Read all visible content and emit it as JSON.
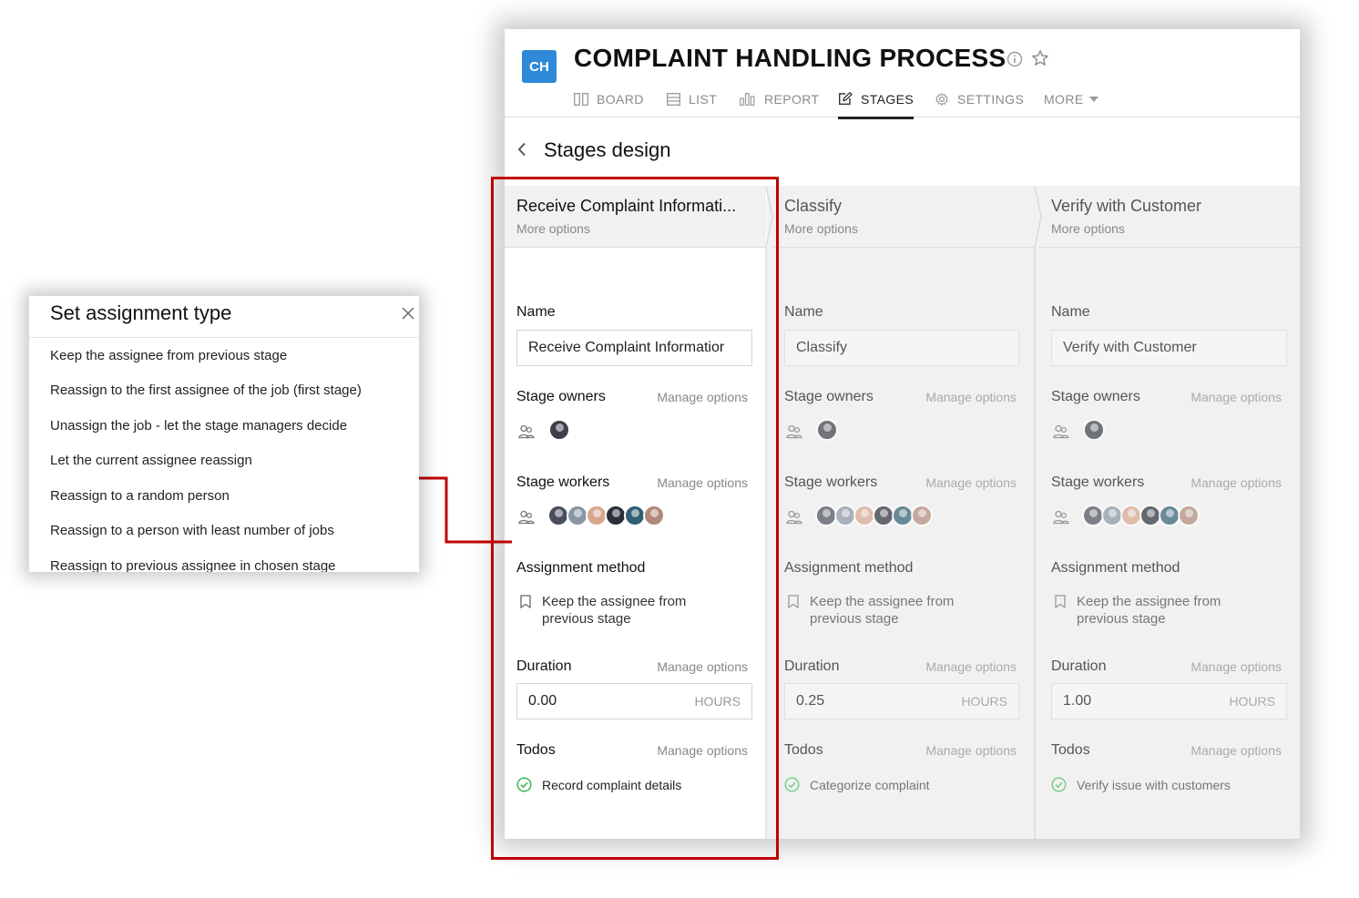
{
  "app": {
    "logo": "CH",
    "title": "COMPLAINT HANDLING PROCESS",
    "tabs": [
      {
        "label": "BOARD",
        "icon": "board-icon"
      },
      {
        "label": "LIST",
        "icon": "list-icon"
      },
      {
        "label": "REPORT",
        "icon": "report-icon"
      },
      {
        "label": "STAGES",
        "icon": "edit-icon",
        "active": true
      },
      {
        "label": "SETTINGS",
        "icon": "gear-icon"
      },
      {
        "label": "MORE",
        "icon": "caret-down-icon"
      }
    ],
    "page_title": "Stages design"
  },
  "labels": {
    "more_options": "More options",
    "name": "Name",
    "stage_owners": "Stage owners",
    "stage_workers": "Stage workers",
    "assignment_method": "Assignment method",
    "duration": "Duration",
    "todos": "Todos",
    "manage_options": "Manage options",
    "hours": "HOURS"
  },
  "stages": [
    {
      "name": "Receive Complaint Informati...",
      "name_value": "Receive Complaint Informatior",
      "assignment": "Keep the assignee from previous stage",
      "duration": "0.00",
      "todo": "Record complaint details"
    },
    {
      "name": "Classify",
      "name_value": "Classify",
      "assignment": "Keep the assignee from previous stage",
      "duration": "0.25",
      "todo": "Categorize complaint"
    },
    {
      "name": "Verify with Customer",
      "name_value": "Verify with Customer",
      "assignment": "Keep the assignee from previous stage",
      "duration": "1.00",
      "todo": "Verify issue with customers"
    }
  ],
  "avatar_colors": {
    "owner": "#3c3f4a",
    "workers": [
      "#4a4e5a",
      "#8a96a4",
      "#d9a78e",
      "#2b2f38",
      "#2f5f74",
      "#b08a78"
    ]
  },
  "popup": {
    "title": "Set assignment type",
    "options": [
      "Keep the assignee from previous stage",
      "Reassign to the first assignee of the job (first stage)",
      "Unassign the job - let the stage managers decide",
      "Let the current assignee reassign",
      "Reassign to a random person",
      "Reassign to a person with least number of jobs",
      "Reassign to previous assignee in chosen stage"
    ]
  },
  "colors": {
    "accent": "#2e8ad8",
    "annotation": "#c00000",
    "todo_check": "#2bb24c"
  }
}
